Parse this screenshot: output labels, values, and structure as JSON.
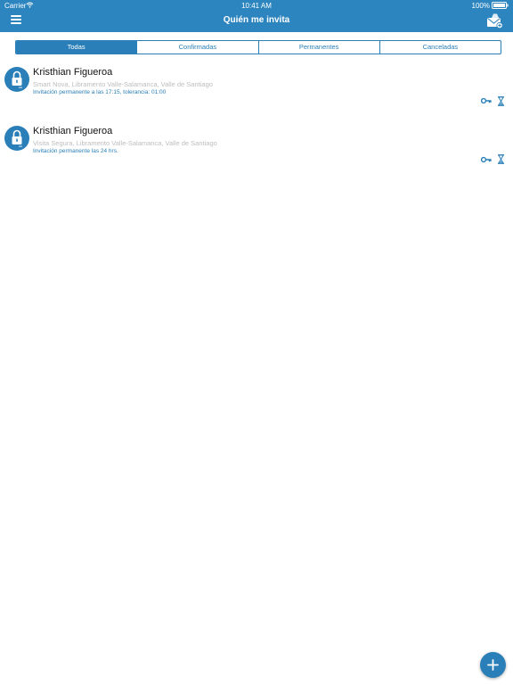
{
  "status_bar": {
    "carrier": "Carrier",
    "time": "10:41 AM",
    "battery": "100%"
  },
  "nav": {
    "title": "Quién me invita",
    "menu_icon": "hamburger-menu-icon",
    "action_icon": "envelope-add-icon"
  },
  "tabs": [
    {
      "label": "Todas",
      "active": true
    },
    {
      "label": "Confirmadas",
      "active": false
    },
    {
      "label": "Permanentes",
      "active": false
    },
    {
      "label": "Canceladas",
      "active": false
    }
  ],
  "invitations": [
    {
      "icon": "padlock-icon",
      "name": "Kristhian Figueroa",
      "address": "Smart Nova, Libramento Valle-Salamanca, Valle de Santiago",
      "schedule": "Invitación permanente a las 17:15, tolerancia: 01:00",
      "actions": [
        "key-icon",
        "hourglass-icon"
      ]
    },
    {
      "icon": "padlock-icon",
      "name": "Kristhian Figueroa",
      "address": "Visita Segura, Libramento Valle-Salamanca, Valle de Santiago",
      "schedule": "Invitación permanente las 24 hrs.",
      "actions": [
        "key-icon",
        "hourglass-icon"
      ]
    }
  ],
  "fab": {
    "icon": "plus-icon"
  },
  "colors": {
    "primary": "#2a7fb8",
    "nav_bar": "#2d85bf",
    "address_text": "#bdbdbd",
    "name_text": "#111111"
  }
}
